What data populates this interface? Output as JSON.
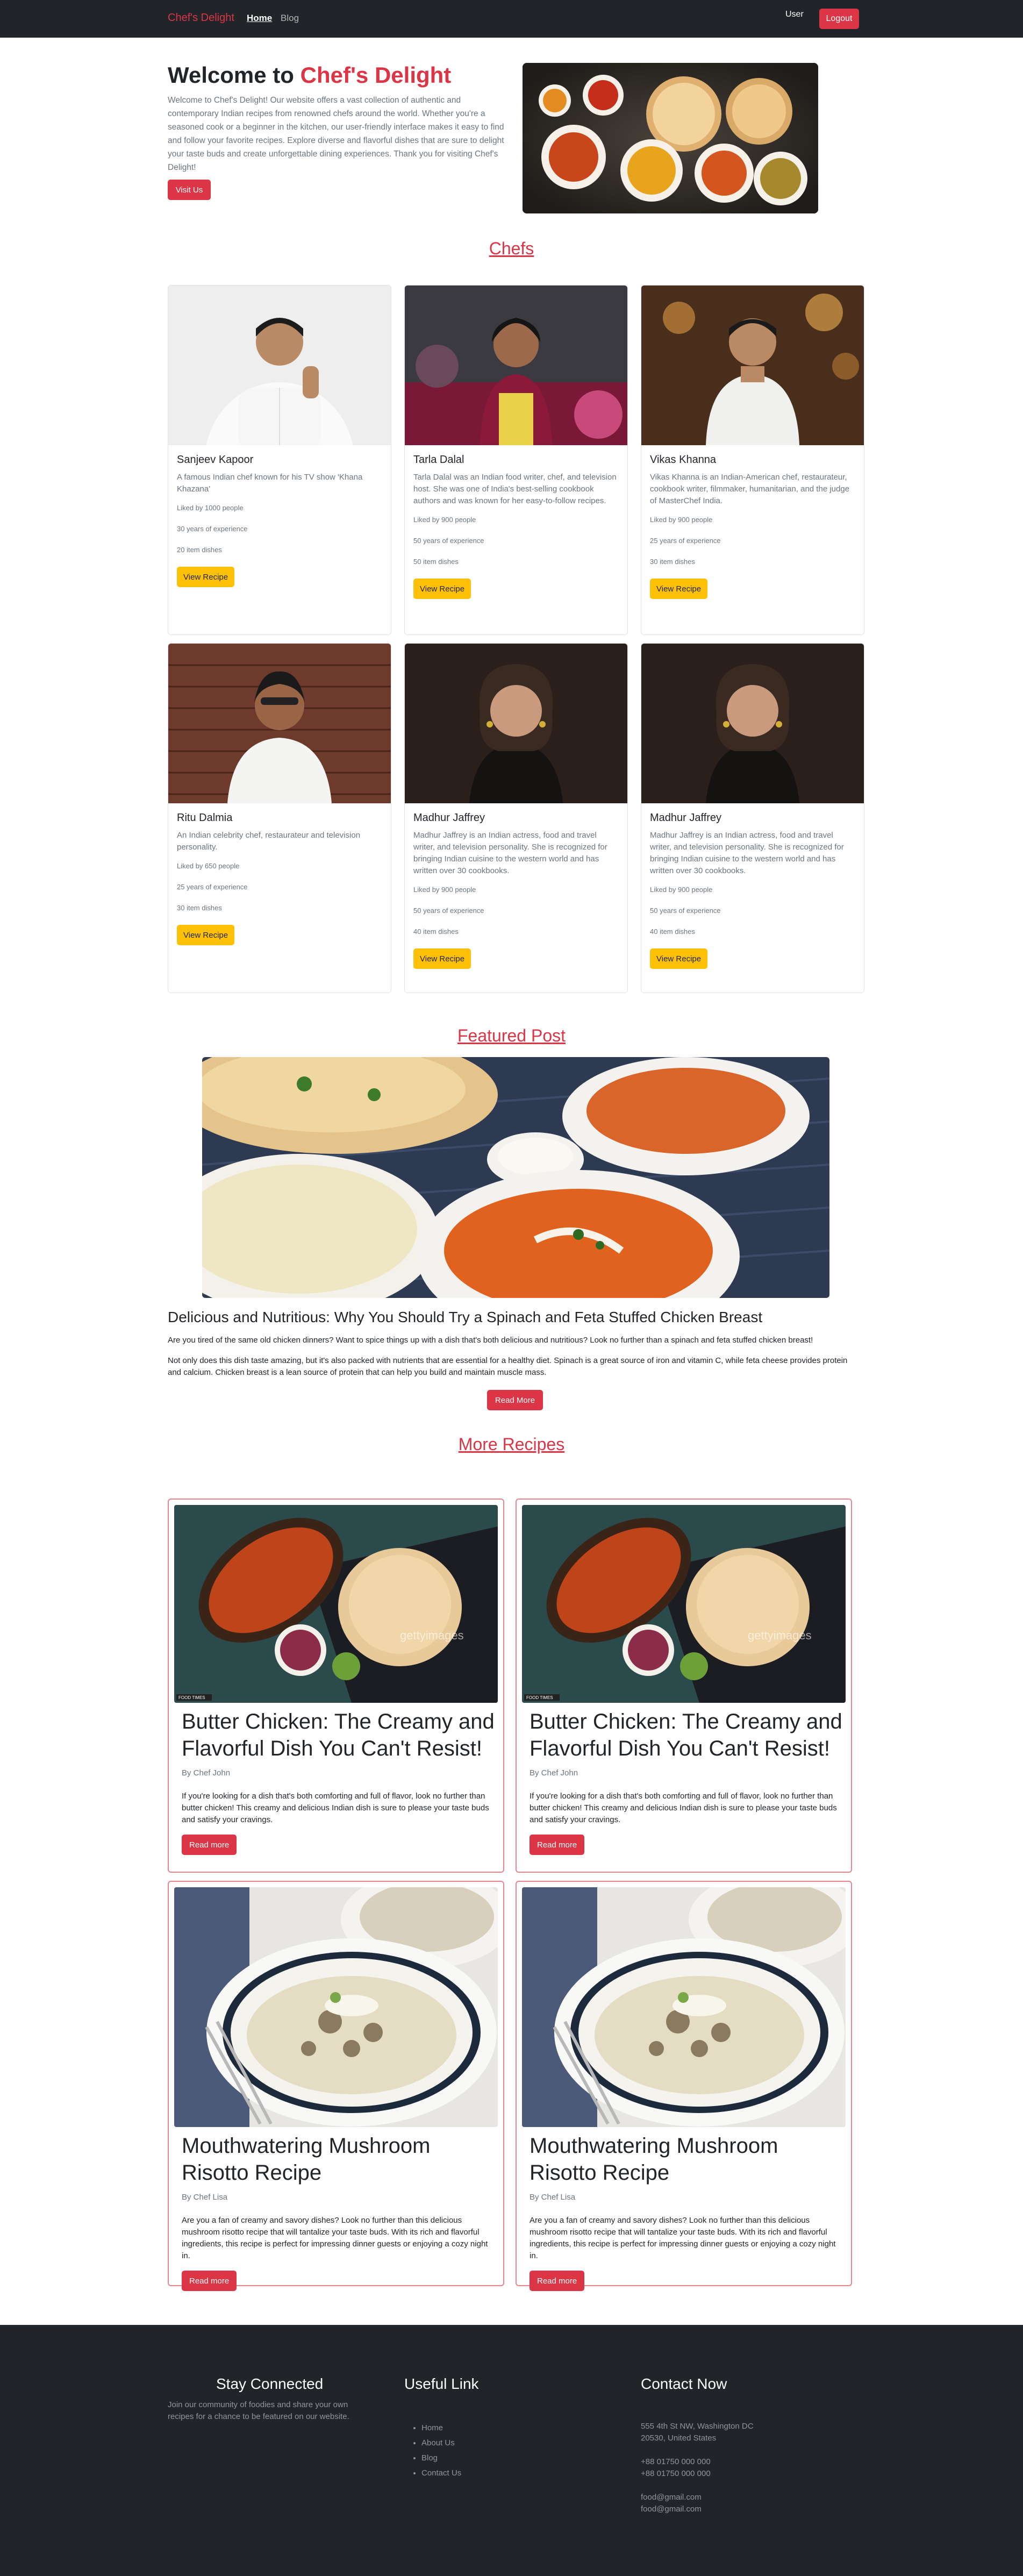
{
  "nav": {
    "brand": "Chef's Delight",
    "home": "Home",
    "blog": "Blog",
    "user": "User",
    "logout": "Logout"
  },
  "hero": {
    "title_prefix": "Welcome to ",
    "title_accent": "Chef's Delight",
    "text": "Welcome to Chef's Delight! Our website offers a vast collection of authentic and contemporary Indian recipes from renowned chefs around the world. Whether you're a seasoned cook or a beginner in the kitchen, our user-friendly interface makes it easy to find and follow your favorite recipes. Explore diverse and flavorful dishes that are sure to delight your taste buds and create unforgettable dining experiences. Thank you for visiting Chef's Delight!",
    "button": "Visit Us"
  },
  "chefs_title": "Chefs",
  "chefs": [
    {
      "name": "Sanjeev Kapoor",
      "desc": "A famous Indian chef known for his TV show 'Khana Khazana'",
      "liked": "Liked by 1000 people",
      "experience": "30 years of experience",
      "dishes": "20 item dishes",
      "button": "View Recipe"
    },
    {
      "name": "Tarla Dalal",
      "desc": "Tarla Dalal was an Indian food writer, chef, and television host. She was one of India's best-selling cookbook authors and was known for her easy-to-follow recipes.",
      "liked": "Liked by 900 people",
      "experience": "50 years of experience",
      "dishes": "50 item dishes",
      "button": "View Recipe"
    },
    {
      "name": "Vikas Khanna",
      "desc": "Vikas Khanna is an Indian-American chef, restaurateur, cookbook writer, filmmaker, humanitarian, and the judge of MasterChef India.",
      "liked": "Liked by 900 people",
      "experience": "25 years of experience",
      "dishes": "30 item dishes",
      "button": "View Recipe"
    },
    {
      "name": "Ritu Dalmia",
      "desc": "An Indian celebrity chef, restaurateur and television personality.",
      "liked": "Liked by 650 people",
      "experience": "25 years of experience",
      "dishes": "30 item dishes",
      "button": "View Recipe"
    },
    {
      "name": "Madhur Jaffrey",
      "desc": "Madhur Jaffrey is an Indian actress, food and travel writer, and television personality. She is recognized for bringing Indian cuisine to the western world and has written over 30 cookbooks.",
      "liked": "Liked by 900 people",
      "experience": "50 years of experience",
      "dishes": "40 item dishes",
      "button": "View Recipe"
    },
    {
      "name": "Madhur Jaffrey",
      "desc": "Madhur Jaffrey is an Indian actress, food and travel writer, and television personality. She is recognized for bringing Indian cuisine to the western world and has written over 30 cookbooks.",
      "liked": "Liked by 900 people",
      "experience": "50 years of experience",
      "dishes": "40 item dishes",
      "button": "View Recipe"
    }
  ],
  "featured": {
    "section_title": "Featured Post",
    "title": "Delicious and Nutritious: Why You Should Try a Spinach and Feta Stuffed Chicken Breast",
    "p1": "Are you tired of the same old chicken dinners? Want to spice things up with a dish that's both delicious and nutritious? Look no further than a spinach and feta stuffed chicken breast!",
    "p2": "Not only does this dish taste amazing, but it's also packed with nutrients that are essential for a healthy diet. Spinach is a great source of iron and vitamin C, while feta cheese provides protein and calcium. Chicken breast is a lean source of protein that can help you build and maintain muscle mass.",
    "button": "Read More"
  },
  "more_title": "More Recipes",
  "recipes": [
    {
      "title": "Butter Chicken: The Creamy and Flavorful Dish You Can't Resist!",
      "author": "By Chef John",
      "text": "If you're looking for a dish that's both comforting and full of flavor, look no further than butter chicken! This creamy and delicious Indian dish is sure to please your taste buds and satisfy your cravings.",
      "button": "Read more",
      "watermark": "gettyimages",
      "badge": "FOOD TIMES"
    },
    {
      "title": "Butter Chicken: The Creamy and Flavorful Dish You Can't Resist!",
      "author": "By Chef John",
      "text": "If you're looking for a dish that's both comforting and full of flavor, look no further than butter chicken! This creamy and delicious Indian dish is sure to please your taste buds and satisfy your cravings.",
      "button": "Read more",
      "watermark": "gettyimages",
      "badge": "FOOD TIMES"
    },
    {
      "title": "Mouthwatering Mushroom Risotto Recipe",
      "author": "By Chef Lisa",
      "text": "Are you a fan of creamy and savory dishes? Look no further than this delicious mushroom risotto recipe that will tantalize your taste buds. With its rich and flavorful ingredients, this recipe is perfect for impressing dinner guests or enjoying a cozy night in.",
      "button": "Read more"
    },
    {
      "title": "Mouthwatering Mushroom Risotto Recipe",
      "author": "By Chef Lisa",
      "text": "Are you a fan of creamy and savory dishes? Look no further than this delicious mushroom risotto recipe that will tantalize your taste buds. With its rich and flavorful ingredients, this recipe is perfect for impressing dinner guests or enjoying a cozy night in.",
      "button": "Read more"
    }
  ],
  "footer": {
    "stay_title": "Stay Connected",
    "stay_text": "Join our community of foodies and share your own recipes for a chance to be featured on our website.",
    "links_title": "Useful Link",
    "links": [
      "Home",
      "About Us",
      "Blog",
      "Contact Us"
    ],
    "contact_title": "Contact Now",
    "address": "555 4th St NW, Washington DC 20530, United States",
    "phone1": "+88 01750 000 000",
    "phone2": "+88 01750 000 000",
    "email1": "food@gmail.com",
    "email2": "food@gmail.com"
  }
}
